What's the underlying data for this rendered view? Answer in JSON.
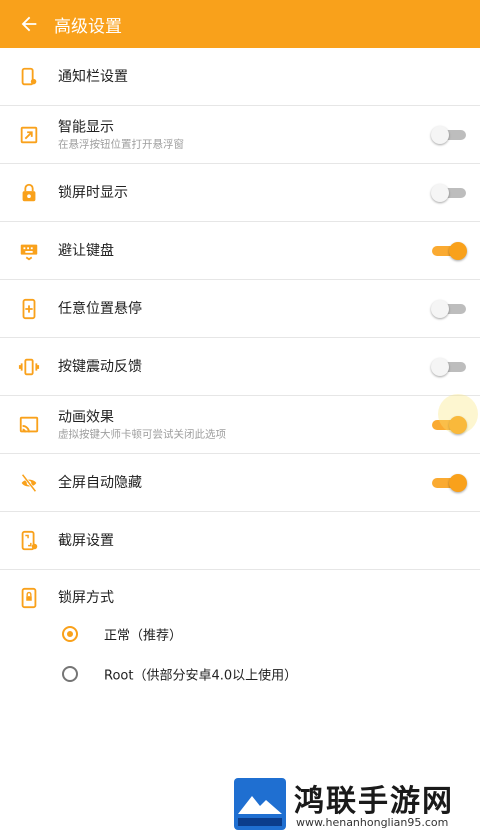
{
  "header": {
    "title": "高级设置",
    "back_icon": "arrow-back-icon"
  },
  "colors": {
    "accent": "#F9A11B"
  },
  "settings": [
    {
      "label": "通知栏设置",
      "icon": "notification-icon"
    },
    {
      "label": "智能显示",
      "sub": "在悬浮按钮位置打开悬浮窗",
      "toggle": "off",
      "icon": "smart-display-icon"
    },
    {
      "label": "锁屏时显示",
      "toggle": "off",
      "icon": "lock-icon"
    },
    {
      "label": "避让键盘",
      "toggle": "on",
      "icon": "keyboard-icon"
    },
    {
      "label": "任意位置悬停",
      "toggle": "off",
      "icon": "hover-icon"
    },
    {
      "label": "按键震动反馈",
      "toggle": "off",
      "icon": "vibrate-icon"
    },
    {
      "label": "动画效果",
      "sub": "虚拟按键大师卡顿可尝试关闭此选项",
      "toggle": "on",
      "icon": "cast-icon"
    },
    {
      "label": "全屏自动隐藏",
      "toggle": "on",
      "icon": "hide-icon"
    },
    {
      "label": "截屏设置",
      "icon": "screenshot-icon"
    },
    {
      "label": "锁屏方式",
      "icon": "lock-mode-icon"
    }
  ],
  "lock_options": [
    {
      "label": "正常（推荐）",
      "selected": true
    },
    {
      "label": "Root（供部分安卓4.0以上使用）",
      "selected": false
    }
  ],
  "watermark": {
    "text": "鸿联手游网",
    "url": "www.henanhonglian95.com"
  }
}
